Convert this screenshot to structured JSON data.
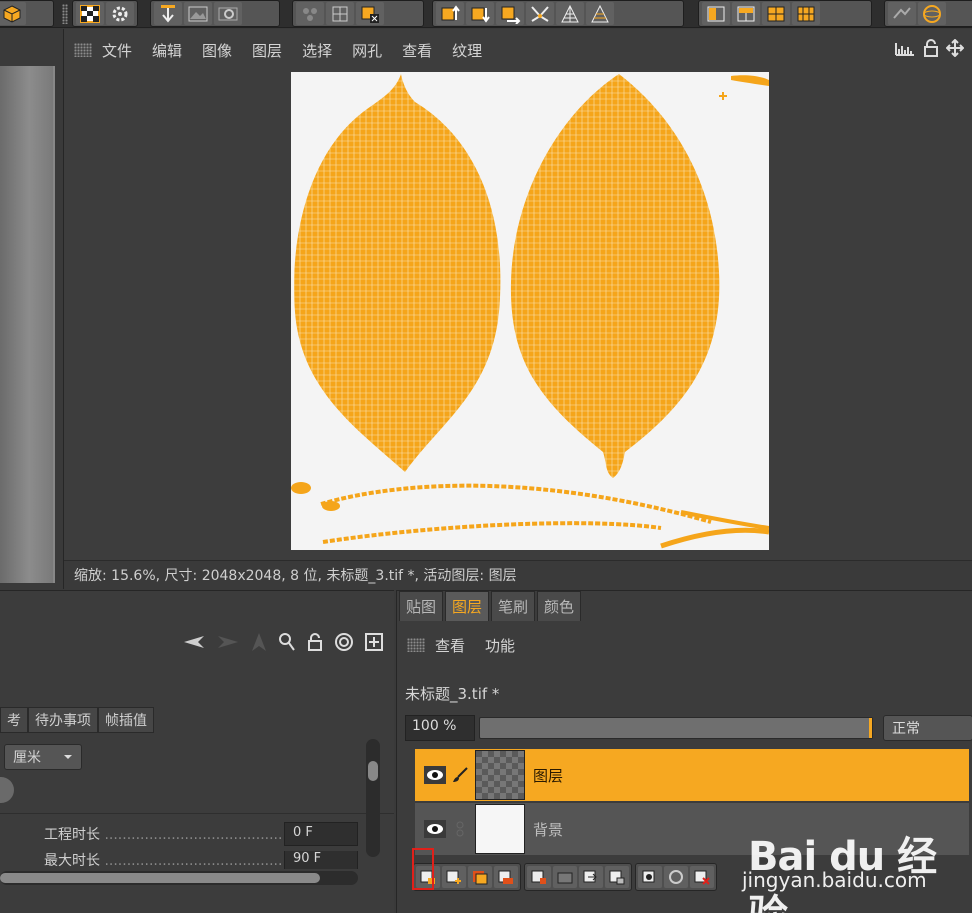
{
  "colors": {
    "accent": "#f6a821",
    "uv_mesh": "#f5a51a",
    "canvas": "#f4f4f4",
    "panel": "#3c3c3c",
    "highlight": "#e0201a"
  },
  "viewer": {
    "menu": [
      "文件",
      "编辑",
      "图像",
      "图层",
      "选择",
      "网孔",
      "查看",
      "纹理"
    ],
    "status": "缩放: 15.6%, 尺寸: 2048x2048, 8 位, 未标题_3.tif *, 活动图层: 图层"
  },
  "attributes": {
    "tabs": [
      "考",
      "待办事项",
      "帧插值"
    ],
    "unit": "厘米",
    "props": [
      {
        "label": "工程时长",
        "value": "0 F"
      },
      {
        "label": "最大时长",
        "value": "90 F"
      }
    ]
  },
  "layers_panel": {
    "tabs": [
      {
        "label": "贴图",
        "active": false
      },
      {
        "label": "图层",
        "active": true
      },
      {
        "label": "笔刷",
        "active": false
      },
      {
        "label": "颜色",
        "active": false
      }
    ],
    "menu": [
      "查看",
      "功能"
    ],
    "document": "未标题_3.tif *",
    "opacity": "100 %",
    "opacity_fraction": 1.0,
    "blend_mode": "正常",
    "layers": [
      {
        "name": "图层",
        "selected": true,
        "thumbnail": "checker"
      },
      {
        "name": "背景",
        "selected": false,
        "thumbnail": "white"
      }
    ]
  },
  "watermark": {
    "logo": "Bai du 经验",
    "site": "jingyan.baidu.com"
  }
}
